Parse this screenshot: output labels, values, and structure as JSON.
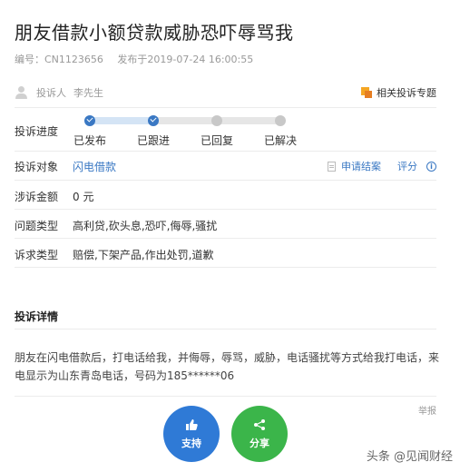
{
  "header": {
    "title": "朋友借款小额贷款威胁恐吓辱骂我",
    "number": "编号：CN1123656",
    "published": "发布于2019-07-24 16:00:55"
  },
  "complainant": {
    "label": "投诉人",
    "name": "李先生",
    "icon": "user-icon"
  },
  "topic_link": {
    "label": "相关投诉专题",
    "icon": "topic-icon"
  },
  "progress": {
    "label": "投诉进度",
    "steps": [
      "已发布",
      "已跟进",
      "已回复",
      "已解决"
    ],
    "completed_steps": 2,
    "active_color": "#3a78c3"
  },
  "target": {
    "label": "投诉对象",
    "value": "闪电借款",
    "apply_label": "申请结案",
    "rate_label": "评分"
  },
  "amount": {
    "label": "涉诉金额",
    "value": "0 元"
  },
  "issue_type": {
    "label": "问题类型",
    "value": "高利贷,砍头息,恐吓,侮辱,骚扰"
  },
  "demand_type": {
    "label": "诉求类型",
    "value": "赔偿,下架产品,作出处罚,道歉"
  },
  "details": {
    "title": "投诉详情",
    "text": "朋友在闪电借款后，打电话给我，并侮辱，辱骂，威胁，电话骚扰等方式给我打电话，来电显示为山东青岛电话，号码为185******06",
    "report_label": "举报"
  },
  "buttons": {
    "support_label": "支持",
    "share_label": "分享",
    "support_color": "#2f7ad6",
    "share_color": "#3bb54a"
  },
  "watermark": "头条 @见闻财经"
}
